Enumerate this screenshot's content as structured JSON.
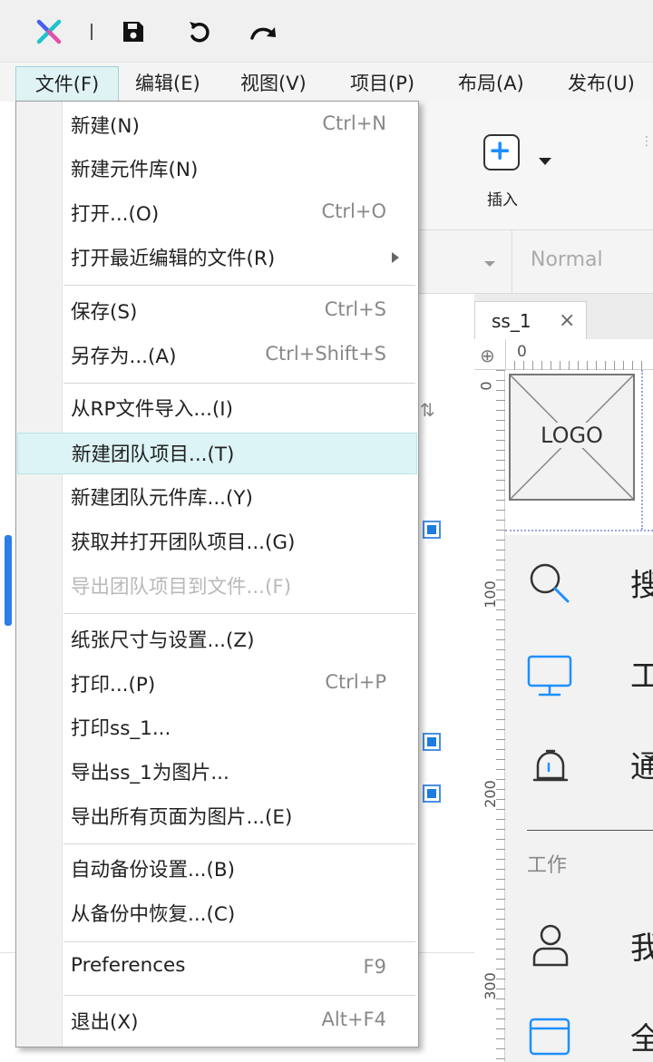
{
  "title_bar": {
    "icons": [
      "app-logo-icon",
      "save-icon",
      "undo-icon",
      "redo-icon"
    ]
  },
  "menubar": {
    "items": [
      {
        "label": "文件(F)"
      },
      {
        "label": "编辑(E)"
      },
      {
        "label": "视图(V)"
      },
      {
        "label": "项目(P)"
      },
      {
        "label": "布局(A)"
      },
      {
        "label": "发布(U)"
      }
    ]
  },
  "toolbar": {
    "insert_label": "插入"
  },
  "format_bar": {
    "style_value": "Normal"
  },
  "document_tabs": {
    "active_tab": "ss_1",
    "close_glyph": "×"
  },
  "rulers": {
    "top_zero": "0",
    "left_zero": "0",
    "left_marks": [
      "100",
      "200",
      "300"
    ]
  },
  "canvas": {
    "logo_placeholder": "LOGO",
    "nav_items": [
      {
        "icon": "search-icon",
        "text": "搜"
      },
      {
        "icon": "monitor-icon",
        "text": "工"
      },
      {
        "icon": "bell-icon",
        "text": "通"
      },
      {
        "icon": "user-icon",
        "text": "我"
      },
      {
        "icon": "window-icon",
        "text": "全"
      }
    ],
    "section_label": "工作"
  },
  "file_menu": {
    "items": [
      {
        "label": "新建(N)",
        "shortcut": "Ctrl+N"
      },
      {
        "label": "新建元件库(N)",
        "shortcut": ""
      },
      {
        "label": "打开...(O)",
        "shortcut": "Ctrl+O"
      },
      {
        "label": "打开最近编辑的文件(R)",
        "shortcut": ""
      },
      {
        "label": "保存(S)",
        "shortcut": "Ctrl+S"
      },
      {
        "label": "另存为...(A)",
        "shortcut": "Ctrl+Shift+S"
      },
      {
        "label": "从RP文件导入...(I)",
        "shortcut": ""
      },
      {
        "label": "新建团队项目...(T)",
        "shortcut": ""
      },
      {
        "label": "新建团队元件库...(Y)",
        "shortcut": ""
      },
      {
        "label": "获取并打开团队项目...(G)",
        "shortcut": ""
      },
      {
        "label": "导出团队项目到文件...(F)",
        "shortcut": ""
      },
      {
        "label": "纸张尺寸与设置...(Z)",
        "shortcut": ""
      },
      {
        "label": "打印...(P)",
        "shortcut": "Ctrl+P"
      },
      {
        "label": "打印ss_1...",
        "shortcut": ""
      },
      {
        "label": "导出ss_1为图片...",
        "shortcut": ""
      },
      {
        "label": "导出所有页面为图片...(E)",
        "shortcut": ""
      },
      {
        "label": "自动备份设置...(B)",
        "shortcut": ""
      },
      {
        "label": "从备份中恢复...(C)",
        "shortcut": ""
      },
      {
        "label": "Preferences",
        "shortcut": "F9"
      },
      {
        "label": "退出(X)",
        "shortcut": "Alt+F4"
      }
    ],
    "highlighted_item": "新建团队项目...(T)",
    "disabled_item": "导出团队项目到文件...(F)",
    "submenu_item": "打开最近编辑的文件(R)"
  },
  "colors": {
    "menu_highlight": "#dcf4f5",
    "accent_blue": "#1e90ff",
    "app_logo_teal": "#1fc3c9",
    "app_logo_blue": "#4a5cf0"
  }
}
